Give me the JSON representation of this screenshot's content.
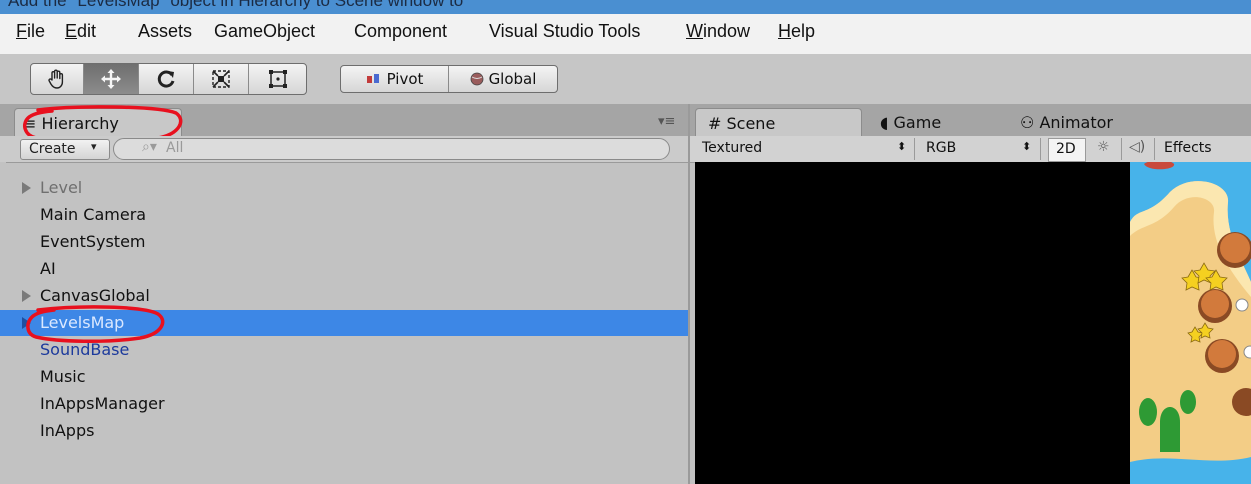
{
  "instruction_banner": "Add the \"LevelsMap\" object in Hierarchy to Scene window to",
  "menu": {
    "items": [
      {
        "label": "File",
        "underline": "F",
        "rest": "ile"
      },
      {
        "label": "Edit",
        "underline": "E",
        "rest": "dit"
      },
      {
        "label": "Assets"
      },
      {
        "label": "GameObject"
      },
      {
        "label": "Component"
      },
      {
        "label": "Visual Studio Tools"
      },
      {
        "label": "Window",
        "underline": "W",
        "rest": "indow"
      },
      {
        "label": "Help",
        "underline": "H",
        "rest": "elp"
      }
    ]
  },
  "toolbar": {
    "tools": [
      "hand-tool",
      "move-tool",
      "rotate-tool",
      "scale-tool",
      "rect-tool"
    ],
    "active_tool": "move-tool",
    "pivot_label": "Pivot",
    "global_label": "Global"
  },
  "hierarchy": {
    "tab_label": "Hierarchy",
    "create_label": "Create",
    "search_placeholder": "All",
    "selection_color": "#3d87e6",
    "annotation_color": "#e8101e",
    "items": [
      {
        "label": "Level",
        "expandable": true,
        "color": "#6f6f6f",
        "selected": false
      },
      {
        "label": "Main Camera",
        "expandable": false,
        "color": "#111111",
        "selected": false
      },
      {
        "label": "EventSystem",
        "expandable": false,
        "color": "#111111",
        "selected": false
      },
      {
        "label": "AI",
        "expandable": false,
        "color": "#111111",
        "selected": false
      },
      {
        "label": "CanvasGlobal",
        "expandable": true,
        "color": "#111111",
        "selected": false
      },
      {
        "label": "LevelsMap",
        "expandable": true,
        "color": "#dbe8ff",
        "selected": true
      },
      {
        "label": "SoundBase",
        "expandable": false,
        "color": "#1c3a9c",
        "selected": false
      },
      {
        "label": "Music",
        "expandable": false,
        "color": "#111111",
        "selected": false
      },
      {
        "label": "InAppsManager",
        "expandable": false,
        "color": "#111111",
        "selected": false
      },
      {
        "label": "InApps",
        "expandable": false,
        "color": "#111111",
        "selected": false
      }
    ]
  },
  "scene": {
    "tabs": [
      {
        "label": "Scene",
        "icon": "hash-icon",
        "active": true
      },
      {
        "label": "Game",
        "icon": "pacman-icon",
        "active": false
      },
      {
        "label": "Animator",
        "icon": "animator-icon",
        "active": false
      }
    ],
    "shading_mode": "Textured",
    "render_mode": "RGB",
    "mode_2d": "2D",
    "effects_label": "Effects"
  }
}
